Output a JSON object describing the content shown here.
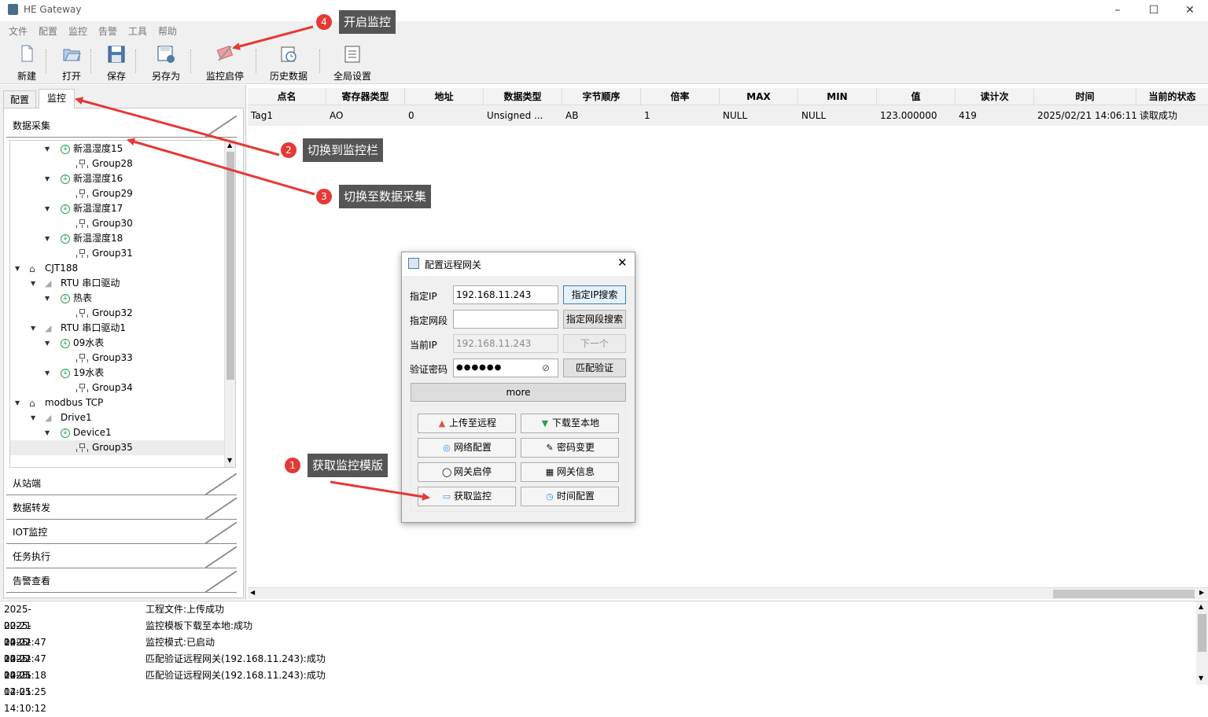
{
  "window": {
    "title": "HE Gateway"
  },
  "menu": [
    "文件",
    "配置",
    "监控",
    "告警",
    "工具",
    "帮助"
  ],
  "toolbar": {
    "new": "新建",
    "open": "打开",
    "save": "保存",
    "save_as": "另存为",
    "monitor_toggle": "监控启停",
    "history": "历史数据",
    "global_settings": "全局设置"
  },
  "left_tabs": {
    "config": "配置",
    "monitor": "监控"
  },
  "accordion": {
    "data_collect": "数据采集",
    "slave": "从站端",
    "forward": "数据转发",
    "iot": "IOT监控",
    "task": "任务执行",
    "alarm": "告警查看"
  },
  "tree": {
    "n1": "新温湿度15",
    "g1": "Group28",
    "n2": "新温湿度16",
    "g2": "Group29",
    "n3": "新温湿度17",
    "g3": "Group30",
    "n4": "新温湿度18",
    "g4": "Group31",
    "cjt": "CJT188",
    "rtu1": "RTU 串口驱动",
    "heat": "热表",
    "g5": "Group32",
    "rtu2": "RTU 串口驱动1",
    "w09": "09水表",
    "g6": "Group33",
    "w19": "19水表",
    "g7": "Group34",
    "mtcp": "modbus TCP",
    "drive1": "Drive1",
    "device1": "Device1",
    "g8": "Group35"
  },
  "grid": {
    "headers": [
      "点名",
      "寄存器类型",
      "地址",
      "数据类型",
      "字节顺序",
      "倍率",
      "MAX",
      "MIN",
      "值",
      "读计次",
      "时间",
      "当前的状态"
    ],
    "rows": [
      [
        "Tag1",
        "AO",
        "0",
        "Unsigned ...",
        "AB",
        "1",
        "NULL",
        "NULL",
        "123.000000",
        "419",
        "2025/02/21 14:06:11",
        "读取成功"
      ]
    ]
  },
  "log": [
    {
      "ts": "2025-02-21 14:02:47",
      "msg": "工程文件:上传成功"
    },
    {
      "ts": "2025-02-21 14:02:47",
      "msg": "监控模板下载至本地:成功"
    },
    {
      "ts": "2025-02-21 14:05:18",
      "msg": "监控模式:已启动"
    },
    {
      "ts": "2025-02-21 14:05:25",
      "msg": "匹配验证远程网关(192.168.11.243):成功"
    },
    {
      "ts": "2025-02-21 14:10:12",
      "msg": "匹配验证远程网关(192.168.11.243):成功"
    }
  ],
  "dialog": {
    "title": "配置远程网关",
    "label_ip": "指定IP",
    "ip_value": "192.168.11.243",
    "btn_ip_search": "指定IP搜索",
    "label_segment": "指定网段",
    "segment_value": "",
    "btn_segment_search": "指定网段搜索",
    "label_current_ip": "当前IP",
    "current_ip_value": "192.168.11.243",
    "btn_next": "下一个",
    "label_password": "验证密码",
    "password_mask": "●●●●●●",
    "btn_match": "匹配验证",
    "btn_more": "more",
    "btn_upload": "上传至远程",
    "btn_download": "下载至本地",
    "btn_network": "网络配置",
    "btn_password_change": "密码变更",
    "btn_gateway_toggle": "网关启停",
    "btn_gateway_info": "网关信息",
    "btn_get_monitor": "获取监控",
    "btn_time_config": "时间配置"
  },
  "callouts": {
    "c1_num": "1",
    "c1_text": "获取监控模版",
    "c2_num": "2",
    "c2_text": "切换到监控栏",
    "c3_num": "3",
    "c3_text": "切换至数据采集",
    "c4_num": "4",
    "c4_text": "开启监控"
  },
  "colors": {
    "callout_bg": "#555555",
    "badge": "#e53935",
    "arrow": "#e53935",
    "tree_icon": "#2e9e4f"
  }
}
